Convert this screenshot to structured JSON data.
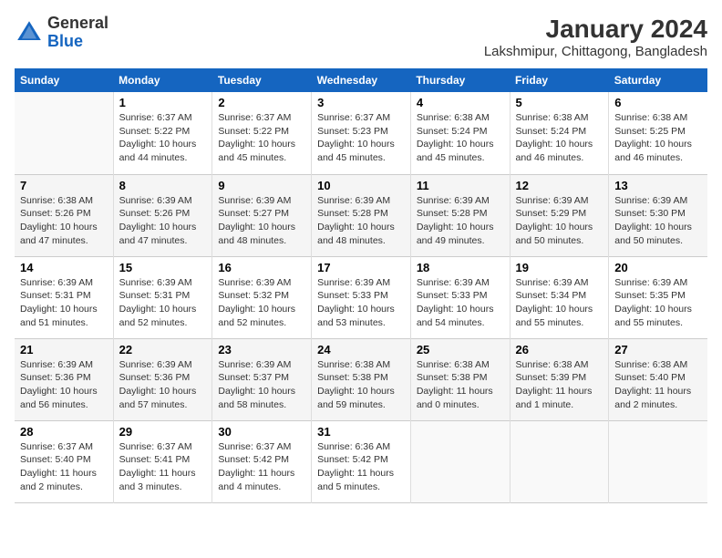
{
  "logo": {
    "text_general": "General",
    "text_blue": "Blue"
  },
  "title": "January 2024",
  "subtitle": "Lakshmipur, Chittagong, Bangladesh",
  "days_of_week": [
    "Sunday",
    "Monday",
    "Tuesday",
    "Wednesday",
    "Thursday",
    "Friday",
    "Saturday"
  ],
  "weeks": [
    [
      {
        "day": "",
        "info": ""
      },
      {
        "day": "1",
        "info": "Sunrise: 6:37 AM\nSunset: 5:22 PM\nDaylight: 10 hours\nand 44 minutes."
      },
      {
        "day": "2",
        "info": "Sunrise: 6:37 AM\nSunset: 5:22 PM\nDaylight: 10 hours\nand 45 minutes."
      },
      {
        "day": "3",
        "info": "Sunrise: 6:37 AM\nSunset: 5:23 PM\nDaylight: 10 hours\nand 45 minutes."
      },
      {
        "day": "4",
        "info": "Sunrise: 6:38 AM\nSunset: 5:24 PM\nDaylight: 10 hours\nand 45 minutes."
      },
      {
        "day": "5",
        "info": "Sunrise: 6:38 AM\nSunset: 5:24 PM\nDaylight: 10 hours\nand 46 minutes."
      },
      {
        "day": "6",
        "info": "Sunrise: 6:38 AM\nSunset: 5:25 PM\nDaylight: 10 hours\nand 46 minutes."
      }
    ],
    [
      {
        "day": "7",
        "info": "Sunrise: 6:38 AM\nSunset: 5:26 PM\nDaylight: 10 hours\nand 47 minutes."
      },
      {
        "day": "8",
        "info": "Sunrise: 6:39 AM\nSunset: 5:26 PM\nDaylight: 10 hours\nand 47 minutes."
      },
      {
        "day": "9",
        "info": "Sunrise: 6:39 AM\nSunset: 5:27 PM\nDaylight: 10 hours\nand 48 minutes."
      },
      {
        "day": "10",
        "info": "Sunrise: 6:39 AM\nSunset: 5:28 PM\nDaylight: 10 hours\nand 48 minutes."
      },
      {
        "day": "11",
        "info": "Sunrise: 6:39 AM\nSunset: 5:28 PM\nDaylight: 10 hours\nand 49 minutes."
      },
      {
        "day": "12",
        "info": "Sunrise: 6:39 AM\nSunset: 5:29 PM\nDaylight: 10 hours\nand 50 minutes."
      },
      {
        "day": "13",
        "info": "Sunrise: 6:39 AM\nSunset: 5:30 PM\nDaylight: 10 hours\nand 50 minutes."
      }
    ],
    [
      {
        "day": "14",
        "info": "Sunrise: 6:39 AM\nSunset: 5:31 PM\nDaylight: 10 hours\nand 51 minutes."
      },
      {
        "day": "15",
        "info": "Sunrise: 6:39 AM\nSunset: 5:31 PM\nDaylight: 10 hours\nand 52 minutes."
      },
      {
        "day": "16",
        "info": "Sunrise: 6:39 AM\nSunset: 5:32 PM\nDaylight: 10 hours\nand 52 minutes."
      },
      {
        "day": "17",
        "info": "Sunrise: 6:39 AM\nSunset: 5:33 PM\nDaylight: 10 hours\nand 53 minutes."
      },
      {
        "day": "18",
        "info": "Sunrise: 6:39 AM\nSunset: 5:33 PM\nDaylight: 10 hours\nand 54 minutes."
      },
      {
        "day": "19",
        "info": "Sunrise: 6:39 AM\nSunset: 5:34 PM\nDaylight: 10 hours\nand 55 minutes."
      },
      {
        "day": "20",
        "info": "Sunrise: 6:39 AM\nSunset: 5:35 PM\nDaylight: 10 hours\nand 55 minutes."
      }
    ],
    [
      {
        "day": "21",
        "info": "Sunrise: 6:39 AM\nSunset: 5:36 PM\nDaylight: 10 hours\nand 56 minutes."
      },
      {
        "day": "22",
        "info": "Sunrise: 6:39 AM\nSunset: 5:36 PM\nDaylight: 10 hours\nand 57 minutes."
      },
      {
        "day": "23",
        "info": "Sunrise: 6:39 AM\nSunset: 5:37 PM\nDaylight: 10 hours\nand 58 minutes."
      },
      {
        "day": "24",
        "info": "Sunrise: 6:38 AM\nSunset: 5:38 PM\nDaylight: 10 hours\nand 59 minutes."
      },
      {
        "day": "25",
        "info": "Sunrise: 6:38 AM\nSunset: 5:38 PM\nDaylight: 11 hours\nand 0 minutes."
      },
      {
        "day": "26",
        "info": "Sunrise: 6:38 AM\nSunset: 5:39 PM\nDaylight: 11 hours\nand 1 minute."
      },
      {
        "day": "27",
        "info": "Sunrise: 6:38 AM\nSunset: 5:40 PM\nDaylight: 11 hours\nand 2 minutes."
      }
    ],
    [
      {
        "day": "28",
        "info": "Sunrise: 6:37 AM\nSunset: 5:40 PM\nDaylight: 11 hours\nand 2 minutes."
      },
      {
        "day": "29",
        "info": "Sunrise: 6:37 AM\nSunset: 5:41 PM\nDaylight: 11 hours\nand 3 minutes."
      },
      {
        "day": "30",
        "info": "Sunrise: 6:37 AM\nSunset: 5:42 PM\nDaylight: 11 hours\nand 4 minutes."
      },
      {
        "day": "31",
        "info": "Sunrise: 6:36 AM\nSunset: 5:42 PM\nDaylight: 11 hours\nand 5 minutes."
      },
      {
        "day": "",
        "info": ""
      },
      {
        "day": "",
        "info": ""
      },
      {
        "day": "",
        "info": ""
      }
    ]
  ]
}
